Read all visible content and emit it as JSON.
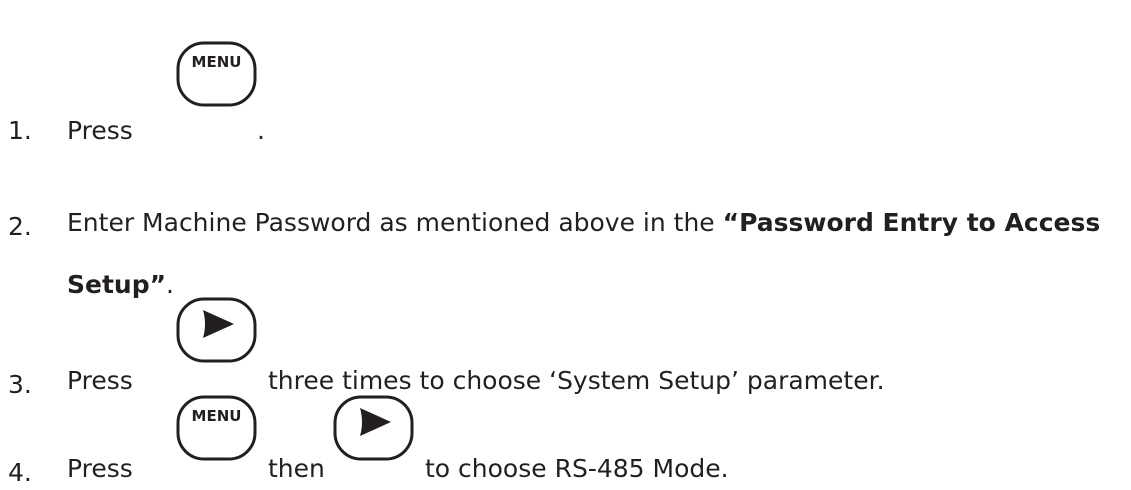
{
  "steps": [
    {
      "number": "1.",
      "press": "Press",
      "end": "."
    },
    {
      "number": "2.",
      "text_before": "Enter Machine Password as mentioned above in the ",
      "bold_ref": "“Password Entry to Access",
      "bold_cont": "Setup”",
      "end": "."
    },
    {
      "number": "3.",
      "press": "Press",
      "rest": "three times to choose ‘System Setup’ parameter."
    },
    {
      "number": "4.",
      "press": "Press",
      "then": "then",
      "rest": "to choose RS-485 Mode."
    }
  ],
  "keys": {
    "menu_label": "MENU",
    "arrow_icon": "right-arrow-icon"
  }
}
